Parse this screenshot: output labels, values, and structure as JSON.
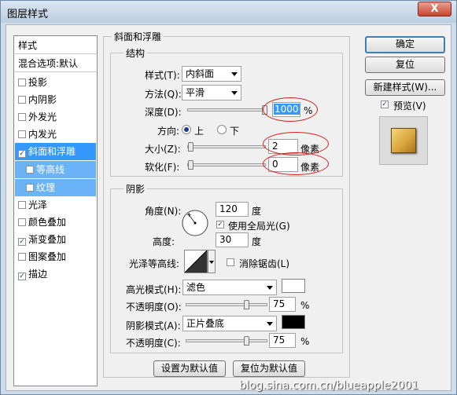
{
  "window": {
    "title": "图层样式",
    "close": "X"
  },
  "left_panel": {
    "header": "样式",
    "blend": "混合选项:默认",
    "items": [
      {
        "label": "投影",
        "checked": false
      },
      {
        "label": "内阴影",
        "checked": false
      },
      {
        "label": "外发光",
        "checked": false
      },
      {
        "label": "内发光",
        "checked": false
      },
      {
        "label": "斜面和浮雕",
        "checked": true,
        "selected": true
      },
      {
        "label": "等高线",
        "checked": false,
        "sub": true
      },
      {
        "label": "纹理",
        "checked": false,
        "sub": true
      },
      {
        "label": "光泽",
        "checked": false
      },
      {
        "label": "颜色叠加",
        "checked": false
      },
      {
        "label": "渐变叠加",
        "checked": true
      },
      {
        "label": "图案叠加",
        "checked": false
      },
      {
        "label": "描边",
        "checked": true
      }
    ]
  },
  "bevel": {
    "section_title": "斜面和浮雕",
    "structure": {
      "legend": "结构",
      "style_label": "样式(T):",
      "style_value": "内斜面",
      "method_label": "方法(Q):",
      "method_value": "平滑",
      "depth_label": "深度(D):",
      "depth_value": "1000",
      "depth_unit": "%",
      "direction_label": "方向:",
      "dir_up": "上",
      "dir_down": "下",
      "size_label": "大小(Z):",
      "size_value": "2",
      "size_unit": "像素",
      "soften_label": "软化(F):",
      "soften_value": "0",
      "soften_unit": "像素"
    },
    "shading": {
      "legend": "阴影",
      "angle_label": "角度(N):",
      "angle_value": "120",
      "angle_unit": "度",
      "global_light": "使用全局光(G)",
      "global_light_checked": true,
      "altitude_label": "高度:",
      "altitude_value": "30",
      "altitude_unit": "度",
      "gloss_label": "光泽等高线:",
      "antialias": "消除锯齿(L)",
      "highlight_label": "高光模式(H):",
      "highlight_value": "滤色",
      "highlight_color": "#ffffff",
      "h_opacity_label": "不透明度(O):",
      "h_opacity_value": "75",
      "h_opacity_unit": "%",
      "shadow_label": "阴影模式(A):",
      "shadow_value": "正片叠底",
      "shadow_color": "#000000",
      "s_opacity_label": "不透明度(C):",
      "s_opacity_value": "75",
      "s_opacity_unit": "%"
    },
    "make_default": "设置为默认值",
    "reset_default": "复位为默认值"
  },
  "buttons": {
    "ok": "确定",
    "reset": "复位",
    "new_style": "新建样式(W)...",
    "preview": "预览(V)",
    "preview_checked": true
  },
  "watermark": "blog.sina.com.cn/blueapple2001"
}
